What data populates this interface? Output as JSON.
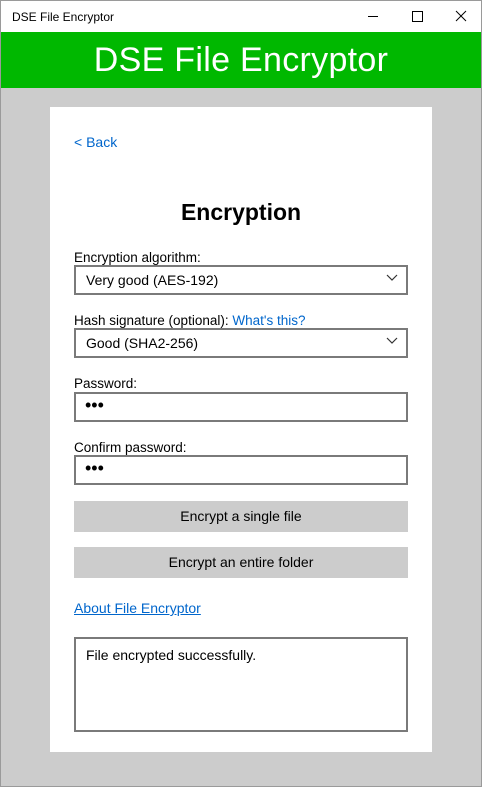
{
  "window": {
    "title": "DSE File Encryptor",
    "minimize_icon": "minimize-icon",
    "maximize_icon": "maximize-icon",
    "close_icon": "close-icon"
  },
  "header": {
    "title": "DSE File Encryptor",
    "background_color": "#00b800"
  },
  "nav": {
    "back_label": "< Back"
  },
  "page": {
    "title": "Encryption"
  },
  "form": {
    "algorithm_label": "Encryption algorithm:",
    "algorithm_value": "Very good (AES-192)",
    "hash_label": "Hash signature (optional):",
    "hash_help_link": "What's this?",
    "hash_value": "Good (SHA2-256)",
    "password_label": "Password:",
    "password_value": "•••",
    "confirm_label": "Confirm password:",
    "confirm_value": "•••"
  },
  "actions": {
    "encrypt_file_label": "Encrypt a single file",
    "encrypt_folder_label": "Encrypt an entire folder",
    "about_link": "About File Encryptor"
  },
  "status": {
    "message": "File encrypted successfully."
  },
  "colors": {
    "accent": "#00b800",
    "link": "#0066cc",
    "button_bg": "#cccccc"
  }
}
